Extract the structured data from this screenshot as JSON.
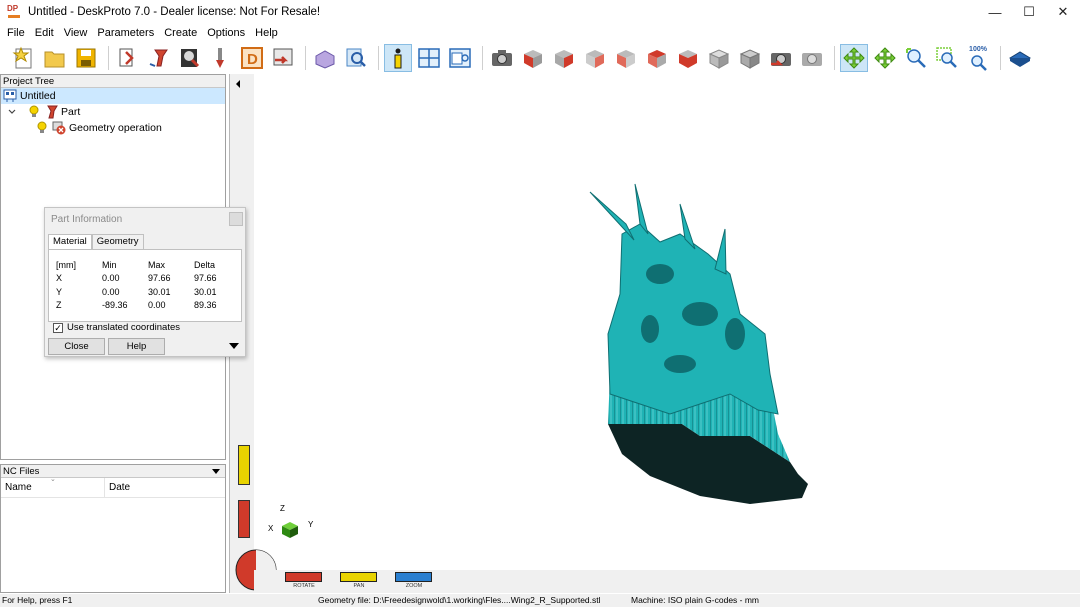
{
  "window": {
    "title": "Untitled - DeskProto 7.0 - Dealer license: Not For Resale!",
    "logo_text": "DP",
    "minimize": "—",
    "maximize": "☐",
    "close": "✕"
  },
  "menu": [
    "File",
    "Edit",
    "View",
    "Parameters",
    "Create",
    "Options",
    "Help"
  ],
  "toolbar": {
    "zoom_label": "100%",
    "buttons": [
      "new-project",
      "open-project",
      "save-project",
      "import-geometry",
      "pick-part",
      "image-import",
      "tool-settings",
      "drawing",
      "export",
      "3d-view",
      "info",
      "tile-view",
      "preview-window",
      "camera",
      "view-front",
      "view-left",
      "view-back",
      "view-right",
      "view-top",
      "view-bottom",
      "view-iso-1",
      "view-iso-2",
      "view-snapshot-a",
      "view-snapshot-b",
      "rotate-view",
      "pan-view",
      "zoom-in-view",
      "zoom-window-view",
      "zoom-100",
      "book"
    ]
  },
  "project_tree": {
    "header": "Project Tree",
    "items": [
      {
        "label": "Untitled"
      },
      {
        "label": "Part"
      },
      {
        "label": "Geometry operation"
      }
    ]
  },
  "part_info": {
    "title": "Part Information",
    "tabs": [
      "Material",
      "Geometry"
    ],
    "columns": [
      "[mm]",
      "Min",
      "Max",
      "Delta"
    ],
    "rows": [
      {
        "axis": "X",
        "min": "0.00",
        "max": "97.66",
        "delta": "97.66"
      },
      {
        "axis": "Y",
        "min": "0.00",
        "max": "30.01",
        "delta": "30.01"
      },
      {
        "axis": "Z",
        "min": "-89.36",
        "max": "0.00",
        "delta": "89.36"
      }
    ],
    "checkbox_label": "Use translated coordinates",
    "checkbox_checked": true,
    "close_label": "Close",
    "help_label": "Help"
  },
  "nc_files": {
    "header": "NC Files",
    "columns": [
      "Name",
      "Date"
    ]
  },
  "viewport": {
    "axis_z": "Z",
    "axis_x": "X",
    "axis_y": "Y",
    "controls": [
      "ROTATE",
      "PAN",
      "ZOOM"
    ],
    "model_color": "#1fb3b5",
    "base_color": "#0d2424"
  },
  "status": {
    "help": "For Help, press F1",
    "geometry": "Geometry file: D:\\Freedesignwold\\1.working\\Fles....Wing2_R_Supported.stl",
    "machine": "Machine: ISO plain G-codes - mm"
  }
}
